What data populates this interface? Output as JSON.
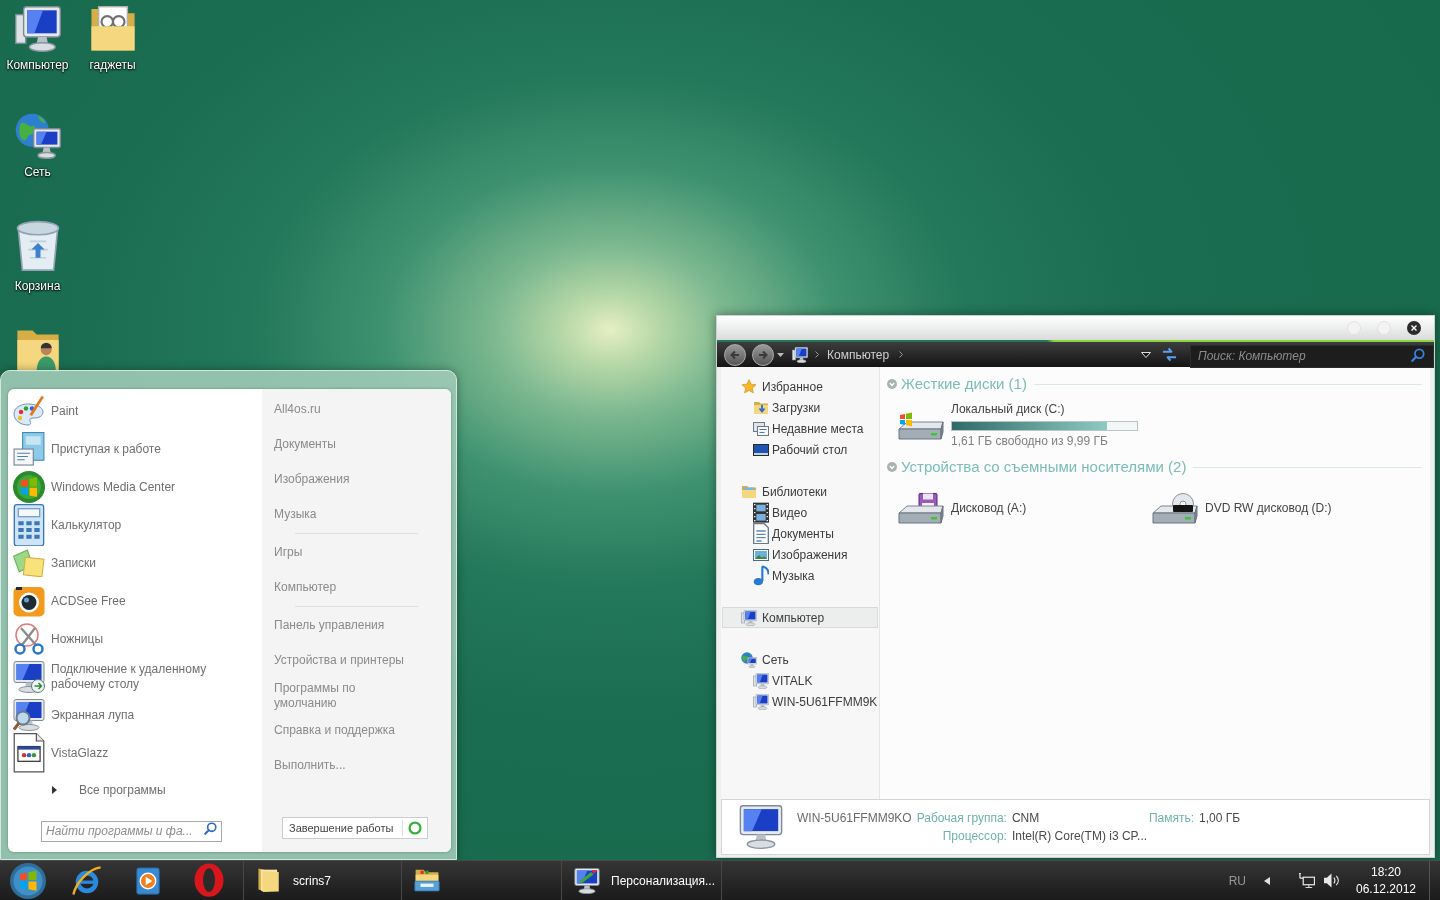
{
  "desktop_icons": [
    {
      "label": "Компьютер"
    },
    {
      "label": "гаджеты"
    },
    {
      "label": "Сеть"
    },
    {
      "label": "Корзина"
    }
  ],
  "start_menu": {
    "programs": [
      "Paint",
      "Приступая к работе",
      "Windows Media Center",
      "Калькулятор",
      "Записки",
      "ACDSee Free",
      "Ножницы",
      "Подключение к удаленному рабочему столу",
      "Экранная лупа",
      "VistaGlazz"
    ],
    "all_programs": "Все программы",
    "search": {
      "placeholder": "Найти программы и фа..."
    },
    "places": [
      [
        "All4os.ru",
        "Документы",
        "Изображения",
        "Музыка"
      ],
      [
        "Игры",
        "Компьютер"
      ],
      [
        "Панель управления",
        "Устройства и принтеры",
        "Программы по умолчанию",
        "Справка и поддержка",
        "Выполнить..."
      ]
    ],
    "shutdown": "Завершение работы"
  },
  "explorer": {
    "breadcrumb": [
      "Компьютер"
    ],
    "search": {
      "placeholder": "Поиск: Компьютер"
    },
    "nav": [
      {
        "label": "Избранное",
        "selected": false,
        "children": [
          {
            "label": "Загрузки",
            "selected": false
          },
          {
            "label": "Недавние места",
            "selected": false
          },
          {
            "label": "Рабочий стол",
            "selected": false
          }
        ]
      },
      {
        "label": "Библиотеки",
        "selected": false,
        "children": [
          {
            "label": "Видео",
            "selected": false
          },
          {
            "label": "Документы",
            "selected": false
          },
          {
            "label": "Изображения",
            "selected": false
          },
          {
            "label": "Музыка",
            "selected": false
          }
        ]
      },
      {
        "label": "Компьютер",
        "selected": true
      },
      {
        "label": "Сеть",
        "selected": false,
        "children": [
          {
            "label": "VITALK",
            "selected": false
          },
          {
            "label": "WIN-5U61FFMM9K",
            "selected": false
          }
        ]
      }
    ],
    "groups": [
      {
        "title": "Жесткие диски (1)",
        "items": [
          {
            "name": "Локальный диск (C:)",
            "level": 0.84,
            "free": "1,61 ГБ свободно из 9,99 ГБ"
          }
        ]
      },
      {
        "title": "Устройства со съемными носителями (2)",
        "items": [
          {
            "name": "Дисковод (A:)"
          },
          {
            "name": "DVD RW дисковод (D:)"
          }
        ]
      }
    ],
    "details": {
      "name": "WIN-5U61FFMM9KO",
      "rows": [
        [
          {
            "label": "Рабочая группа:",
            "value": "CNM"
          },
          {
            "label": "Память:",
            "value": "1,00 ГБ"
          }
        ],
        [
          {
            "label": "Процессор:",
            "value": "Intel(R) Core(TM) i3 CP..."
          }
        ]
      ]
    }
  },
  "taskbar": {
    "items": [
      {
        "kind": "pinned"
      },
      {
        "kind": "pinned"
      },
      {
        "kind": "pinned"
      },
      {
        "kind": "window",
        "label": "scrins7"
      },
      {
        "kind": "window"
      },
      {
        "kind": "window",
        "label": "Персонализация..."
      }
    ],
    "tray": {
      "language": "RU",
      "time": "18:20",
      "date": "06.12.2012"
    }
  }
}
